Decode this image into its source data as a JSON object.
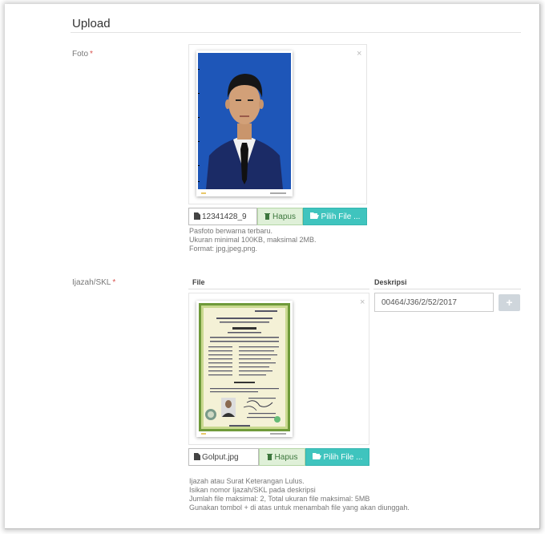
{
  "section": {
    "title": "Upload"
  },
  "foto": {
    "label": "Foto",
    "required_mark": "*",
    "close_glyph": "×",
    "file_name": "12341428_9",
    "delete_label": "Hapus",
    "choose_label": "Pilih File ...",
    "help": [
      "Pasfoto berwarna terbaru.",
      "Ukuran minimal 100KB, maksimal 2MB.",
      "Format: jpg,jpeg,png."
    ]
  },
  "ijazah": {
    "label": "Ijazah/SKL",
    "required_mark": "*",
    "col_file": "File",
    "col_desc": "Deskripsi",
    "close_glyph": "×",
    "file_name": "Golput.jpg",
    "delete_label": "Hapus",
    "choose_label": "Pilih File ...",
    "description_value": "00464/J36/2/52/2017",
    "add_glyph": "+",
    "help": [
      "Ijazah atau Surat Keterangan Lulus.",
      "Isikan nomor Ijazah/SKL pada deskripsi",
      "Jumlah file maksimal: 2, Total ukuran file maksimal: 5MB",
      "Gunakan tombol + di atas untuk menambah file yang akan diunggah."
    ]
  },
  "icons": {
    "file": "file-icon",
    "trash": "trash-icon",
    "folder": "folder-open-icon",
    "close": "close-icon",
    "plus": "plus-icon"
  },
  "colors": {
    "required": "#d9534f",
    "choose_button": "#3fc4be",
    "delete_button_bg": "#dff0d8",
    "photo_background": "#1e56b8"
  }
}
